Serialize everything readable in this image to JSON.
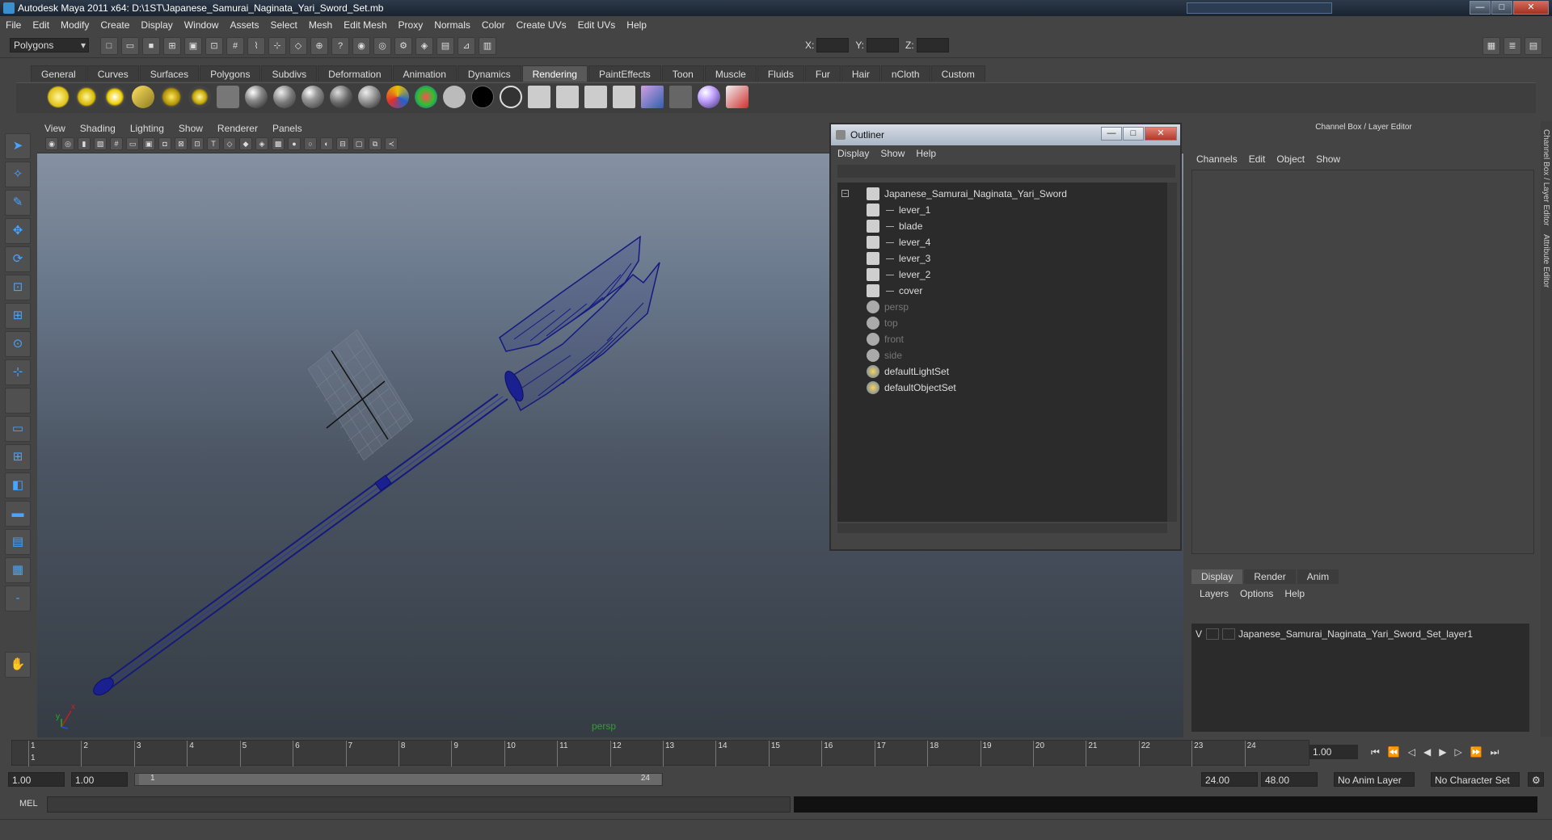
{
  "window": {
    "title": "Autodesk Maya 2011 x64: D:\\1ST\\Japanese_Samurai_Naginata_Yari_Sword_Set.mb"
  },
  "menu": [
    "File",
    "Edit",
    "Modify",
    "Create",
    "Display",
    "Window",
    "Assets",
    "Select",
    "Mesh",
    "Edit Mesh",
    "Proxy",
    "Normals",
    "Color",
    "Create UVs",
    "Edit UVs",
    "Help"
  ],
  "status": {
    "mode": "Polygons",
    "x_label": "X:",
    "y_label": "Y:",
    "z_label": "Z:"
  },
  "shelf": {
    "tabs": [
      "General",
      "Curves",
      "Surfaces",
      "Polygons",
      "Subdivs",
      "Deformation",
      "Animation",
      "Dynamics",
      "Rendering",
      "PaintEffects",
      "Toon",
      "Muscle",
      "Fluids",
      "Fur",
      "Hair",
      "nCloth",
      "Custom"
    ],
    "active_tab": "Rendering"
  },
  "viewport": {
    "menu": [
      "View",
      "Shading",
      "Lighting",
      "Show",
      "Renderer",
      "Panels"
    ],
    "camera_label": "persp",
    "axis_x": "x",
    "axis_y": "y"
  },
  "outliner": {
    "title": "Outliner",
    "menu": [
      "Display",
      "Show",
      "Help"
    ],
    "items": [
      {
        "label": "Japanese_Samurai_Naginata_Yari_Sword",
        "type": "mesh",
        "indent": 0,
        "dim": false,
        "expander": "−"
      },
      {
        "label": "lever_1",
        "type": "mesh",
        "indent": 1,
        "dim": false
      },
      {
        "label": "blade",
        "type": "mesh",
        "indent": 1,
        "dim": false
      },
      {
        "label": "lever_4",
        "type": "mesh",
        "indent": 1,
        "dim": false
      },
      {
        "label": "lever_3",
        "type": "mesh",
        "indent": 1,
        "dim": false
      },
      {
        "label": "lever_2",
        "type": "mesh",
        "indent": 1,
        "dim": false
      },
      {
        "label": "cover",
        "type": "mesh",
        "indent": 1,
        "dim": false
      },
      {
        "label": "persp",
        "type": "cam",
        "indent": 0,
        "dim": true
      },
      {
        "label": "top",
        "type": "cam",
        "indent": 0,
        "dim": true
      },
      {
        "label": "front",
        "type": "cam",
        "indent": 0,
        "dim": true
      },
      {
        "label": "side",
        "type": "cam",
        "indent": 0,
        "dim": true
      },
      {
        "label": "defaultLightSet",
        "type": "set",
        "indent": 0,
        "dim": false
      },
      {
        "label": "defaultObjectSet",
        "type": "set",
        "indent": 0,
        "dim": false
      }
    ]
  },
  "channelbox": {
    "title": "Channel Box / Layer Editor",
    "menu": [
      "Channels",
      "Edit",
      "Object",
      "Show"
    ],
    "display_tabs": [
      "Display",
      "Render",
      "Anim"
    ],
    "active_display_tab": "Display",
    "layer_menu": [
      "Layers",
      "Options",
      "Help"
    ],
    "layers": [
      {
        "visible": "V",
        "name": "Japanese_Samurai_Naginata_Yari_Sword_Set_layer1"
      }
    ],
    "side_tabs": [
      "Channel Box / Layer Editor",
      "Attribute Editor"
    ]
  },
  "timeline": {
    "labels": [
      "1",
      "2",
      "3",
      "4",
      "5",
      "6",
      "7",
      "8",
      "9",
      "10",
      "11",
      "12",
      "13",
      "14",
      "15",
      "16",
      "17",
      "18",
      "19",
      "20",
      "21",
      "22",
      "23",
      "24"
    ],
    "current_frame": "1.00",
    "first_frame_label": "1"
  },
  "range": {
    "start": "1.00",
    "playback_start": "1.00",
    "slider_start": "1",
    "slider_end": "24",
    "playback_end": "24.00",
    "end": "48.00",
    "anim_layer": "No Anim Layer",
    "character_set": "No Character Set"
  },
  "mel": {
    "label": "MEL"
  }
}
